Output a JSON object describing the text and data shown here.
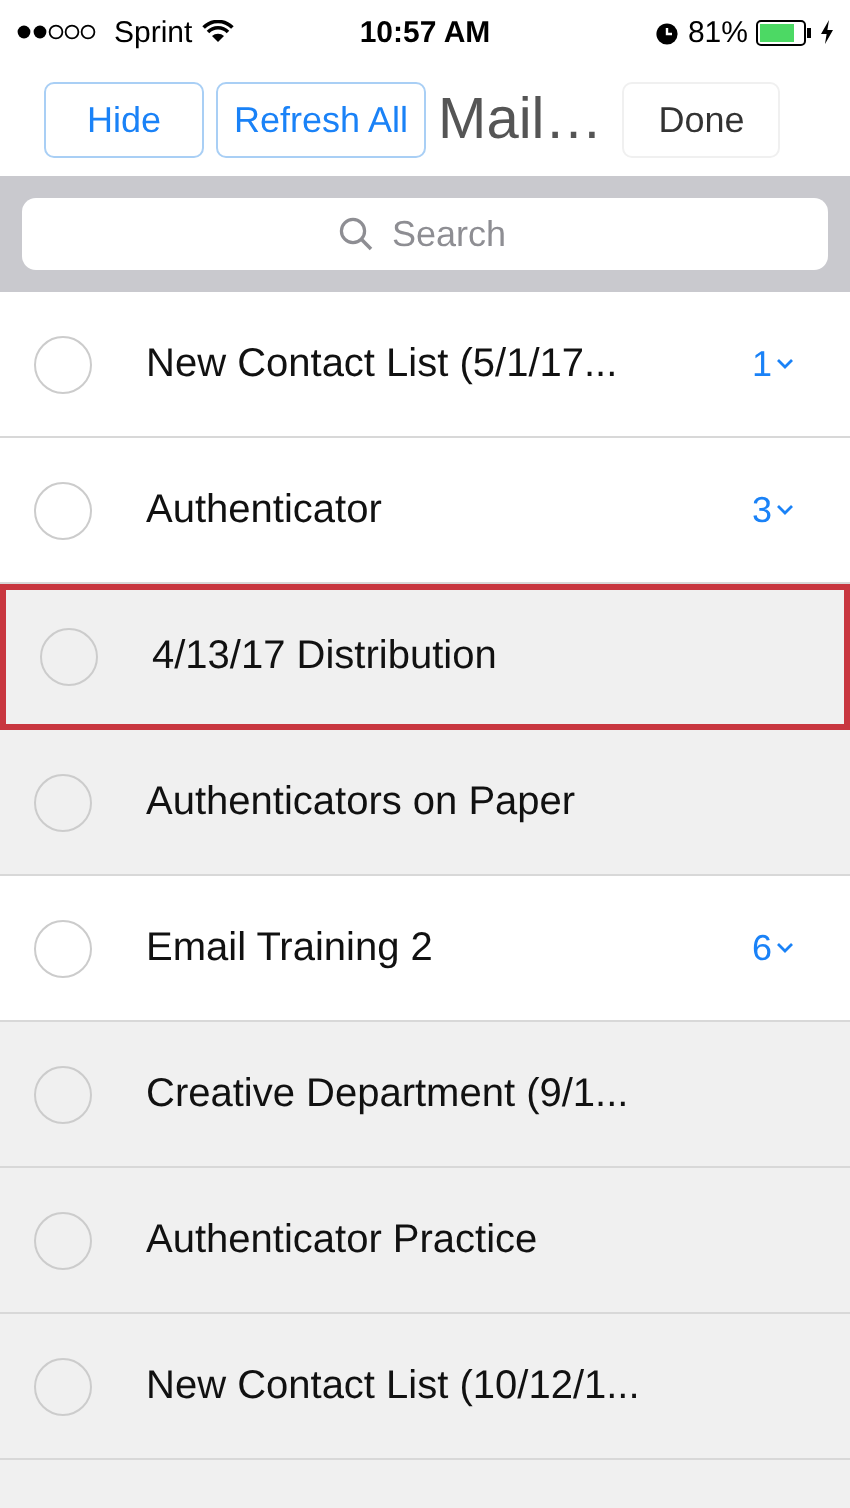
{
  "status_bar": {
    "carrier": "Sprint",
    "time": "10:57 AM",
    "battery_text": "81%"
  },
  "nav": {
    "buttons": [
      {
        "label": "Hide",
        "kind": "outlined"
      },
      {
        "label": "Refresh All",
        "kind": "outlined"
      }
    ],
    "title": "Mail…",
    "done": "Done"
  },
  "search": {
    "placeholder": "Search"
  },
  "items": [
    {
      "title": "New Contact List (5/1/17...",
      "count": "1",
      "shaded": false,
      "selected": false,
      "checked": false
    },
    {
      "title": "Authenticator",
      "count": "3",
      "shaded": false,
      "selected": false,
      "checked": false
    },
    {
      "title": "4/13/17 Distribution",
      "shaded": true,
      "selected": true,
      "checked": false
    },
    {
      "title": "Authenticators on Paper",
      "shaded": true,
      "selected": false,
      "checked": false
    },
    {
      "title": "Email Training 2",
      "count": "6",
      "shaded": false,
      "selected": false,
      "checked": false
    },
    {
      "title": "Creative Department (9/1...",
      "shaded": true,
      "selected": false,
      "checked": false
    },
    {
      "title": "Authenticator Practice",
      "shaded": true,
      "selected": false,
      "checked": false
    },
    {
      "title": "New Contact List (10/12/1...",
      "shaded": true,
      "selected": false,
      "checked": false
    }
  ]
}
